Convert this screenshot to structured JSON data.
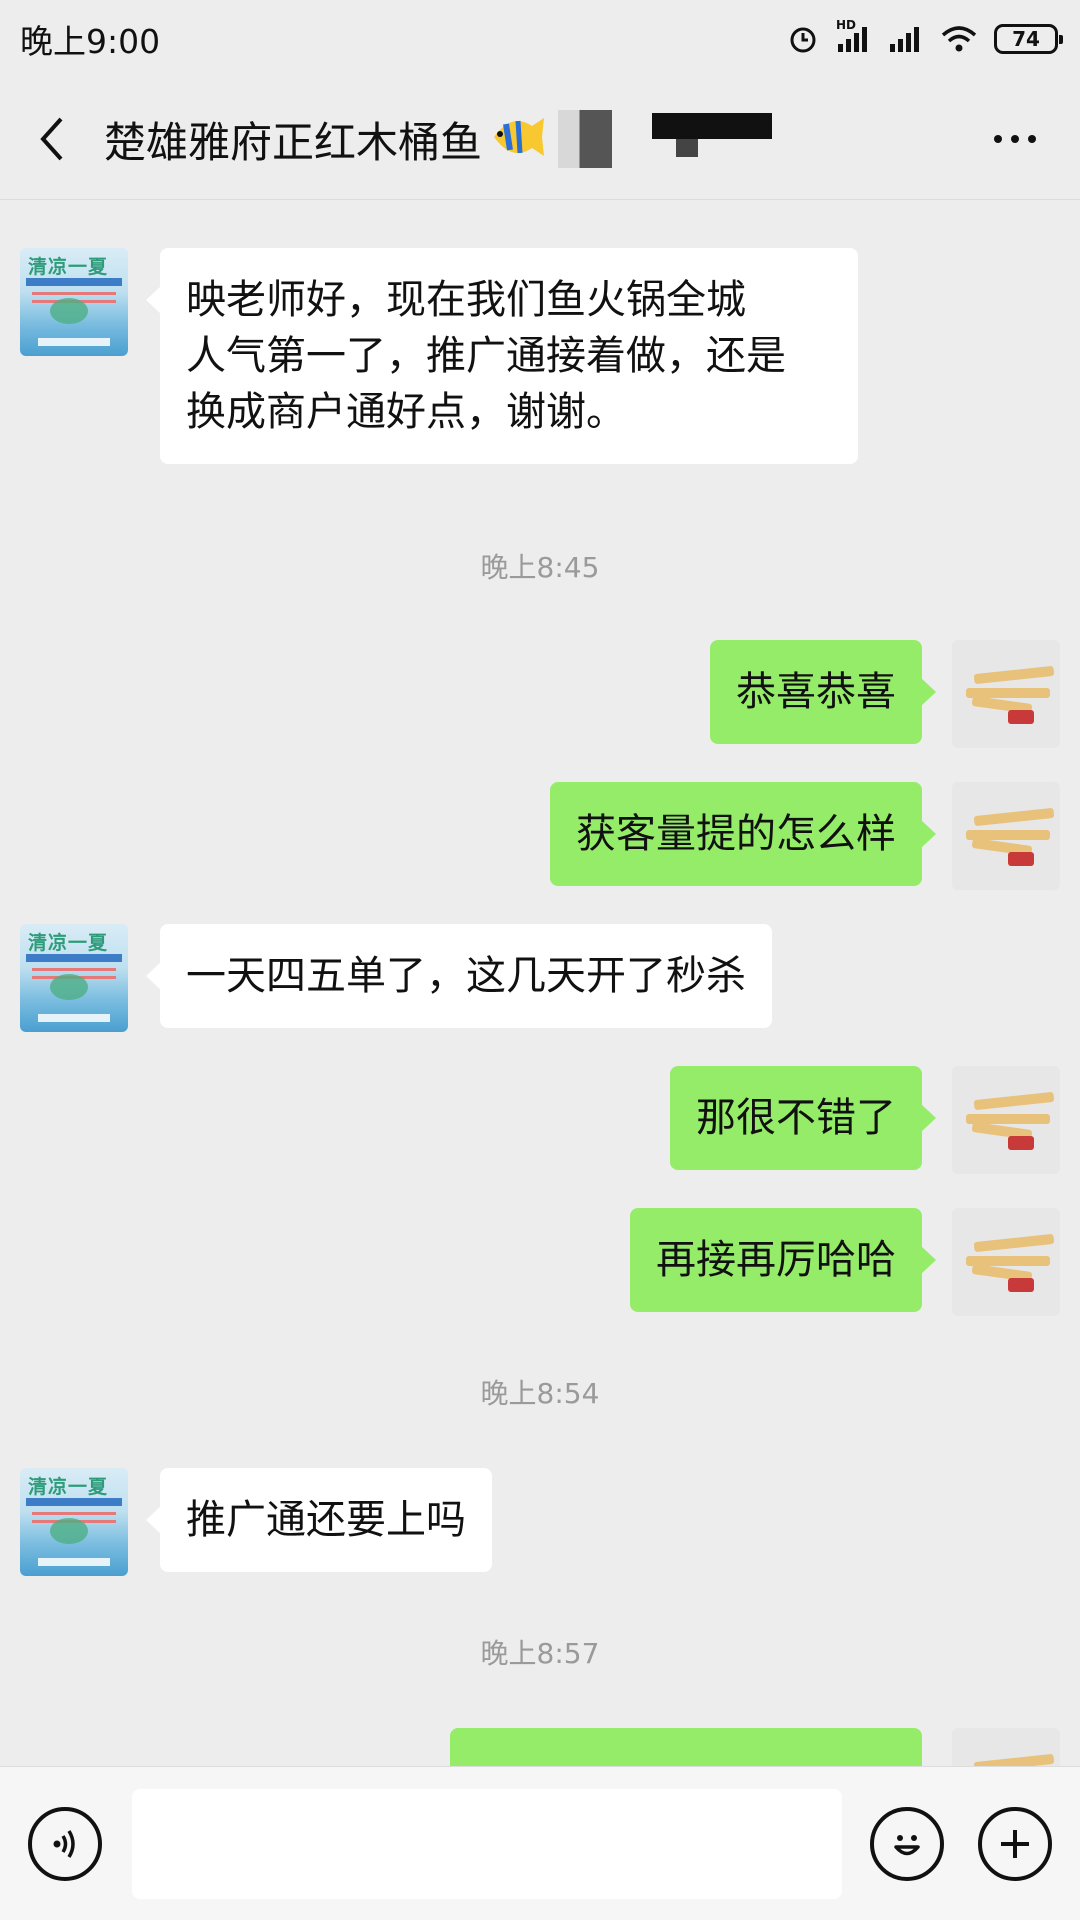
{
  "status_bar": {
    "time": "晚上9:00",
    "network_label": "HD",
    "battery": "74",
    "icons": [
      "alarm-icon",
      "signal-icon",
      "signal-icon",
      "wifi-icon",
      "battery-icon"
    ]
  },
  "header": {
    "title": "楚雄雅府正红木桶鱼",
    "back_icon": "chevron-left-icon",
    "title_emoji": "tropical-fish-icon",
    "more_icon": "more-dots-icon"
  },
  "messages": [
    {
      "side": "left",
      "text": "映老师好，现在我们鱼火锅全城\n人气第一了，推广通接着做，还是\n换成商户通好点，谢谢。"
    },
    {
      "type": "time",
      "text": "晚上8:45"
    },
    {
      "side": "right",
      "text": "恭喜恭喜"
    },
    {
      "side": "right",
      "text": "获客量提的怎么样"
    },
    {
      "side": "left",
      "text": "一天四五单了，这几天开了秒杀"
    },
    {
      "side": "right",
      "text": "那很不错了"
    },
    {
      "side": "right",
      "text": "再接再厉哈哈"
    },
    {
      "type": "time",
      "text": "晚上8:54"
    },
    {
      "side": "left",
      "text": "推广通还要上吗"
    },
    {
      "type": "time",
      "text": "晚上8:57"
    },
    {
      "side": "right",
      "text": ""
    }
  ],
  "contact_avatar": {
    "caption": "清凉一夏"
  },
  "input_bar": {
    "voice_icon": "voice-icon",
    "emoji_icon": "smiley-icon",
    "plus_icon": "plus-circle-icon",
    "placeholder": ""
  },
  "colors": {
    "background": "#ededed",
    "bubble_out": "#95ec69",
    "bubble_in": "#ffffff",
    "timestamp": "#9a9a9a"
  }
}
